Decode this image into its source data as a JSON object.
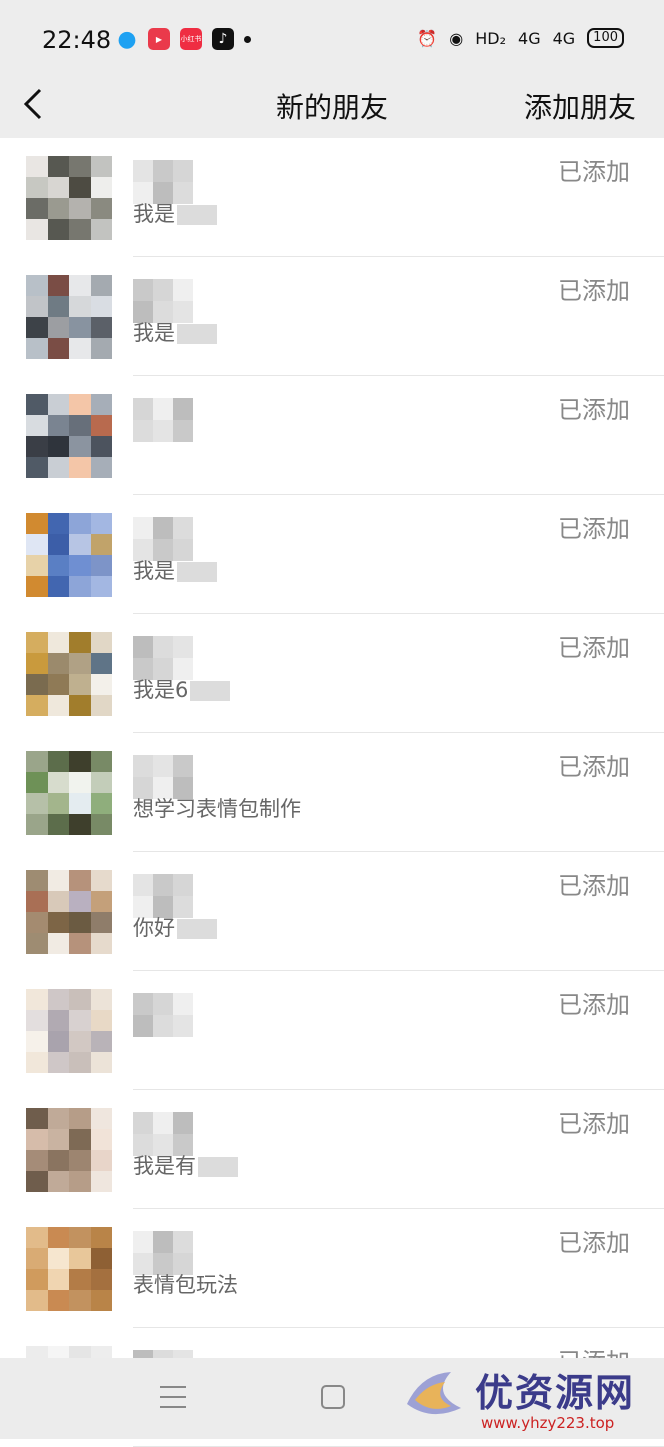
{
  "status_bar": {
    "time": "22:48",
    "network": "HD₂",
    "signal1": "4G",
    "signal2": "4G",
    "battery": "100",
    "app_icons": [
      "qq-icon",
      "screen-record-icon",
      "xiaohongshu-icon",
      "tiktok-icon"
    ],
    "xhs_label": "小红书"
  },
  "title_bar": {
    "title": "新的朋友",
    "action": "添加朋友"
  },
  "friends": [
    {
      "message": "我是",
      "status": "已添加"
    },
    {
      "message": "我是",
      "status": "已添加"
    },
    {
      "message": "",
      "status": "已添加"
    },
    {
      "message": "我是",
      "status": "已添加"
    },
    {
      "message": "我是6",
      "status": "已添加"
    },
    {
      "message": "想学习表情包制作",
      "status": "已添加"
    },
    {
      "message": "你好",
      "status": "已添加"
    },
    {
      "message": "",
      "status": "已添加"
    },
    {
      "message": "我是有",
      "status": "已添加"
    },
    {
      "message": "表情包玩法",
      "status": "已添加"
    },
    {
      "message": "",
      "status": "已添加"
    }
  ],
  "watermark": {
    "name": "优资源网",
    "url": "www.yhzy223.top"
  },
  "colors": {
    "bar_bg": "#ededed",
    "status_text": "#888888",
    "divider": "#e6e6e6"
  }
}
